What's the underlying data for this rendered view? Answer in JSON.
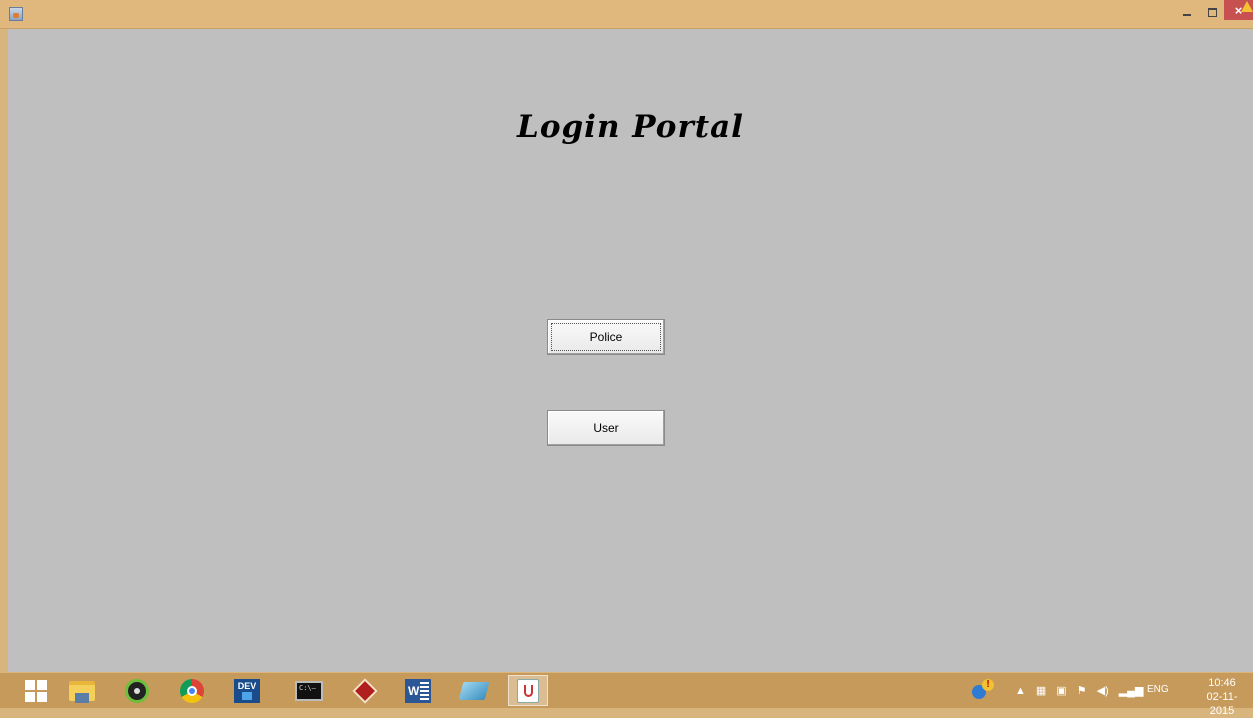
{
  "window": {
    "title": "",
    "icon": "java-app-icon",
    "controls": {
      "minimize_icon": "minimize-icon",
      "maximize_icon": "restore-icon",
      "close_label": "×"
    }
  },
  "content": {
    "title": "Login Portal",
    "buttons": {
      "police": "Police",
      "user": "User"
    },
    "background": "#bfbfbf"
  },
  "taskbar": {
    "apps": [
      {
        "name": "start-button",
        "icon": "windows-logo-icon"
      },
      {
        "name": "file-explorer",
        "icon": "folder-icon"
      },
      {
        "name": "webcam-app",
        "icon": "webcam-icon"
      },
      {
        "name": "chrome",
        "icon": "chrome-icon"
      },
      {
        "name": "dev-cpp",
        "icon": "dev-cpp-icon",
        "label": "DEV"
      },
      {
        "name": "command-prompt",
        "icon": "cmd-icon",
        "label": "C:\\—"
      },
      {
        "name": "red-diamond-app",
        "icon": "red-diamond-icon"
      },
      {
        "name": "word",
        "icon": "word-icon",
        "label": "W"
      },
      {
        "name": "slate-app",
        "icon": "slate-icon"
      },
      {
        "name": "java-app",
        "icon": "java-icon",
        "active": true
      }
    ],
    "tray": {
      "language": "ENG",
      "time": "10:46",
      "date": "02-11-2015"
    },
    "colors": {
      "taskbar": "#c69a5a",
      "titlebar": "#e0b87e",
      "close": "#c75050"
    }
  }
}
